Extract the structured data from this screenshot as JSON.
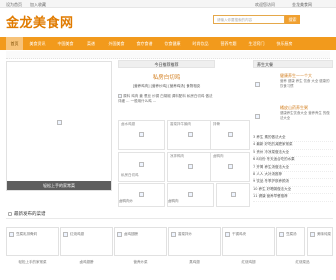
{
  "topbar": {
    "links": [
      "设为首页",
      "加入收藏"
    ],
    "right_link": "金龙美食网",
    "right_extra": "欢迎您访问"
  },
  "header": {
    "logo": "金龙美食网",
    "search_placeholder": "请输入你要搜索的内容",
    "search_button": "搜索"
  },
  "nav": {
    "items": [
      "首页",
      "美食资讯",
      "中国美食",
      "菜谱",
      "外国美食",
      "食疗食谱",
      "饮食健康",
      "时尚饮品",
      "营养专题",
      "生活窍门",
      "快乐厨房"
    ]
  },
  "slider": {
    "caption": "轻松上手的家常菜"
  },
  "center": {
    "title": "今日推荐推荐",
    "article_title": "私房白切鸡",
    "article_links": "[营养鸡肉] [营养炒鸡] [营养鸡汤] 食物相克",
    "summary": "原料 鸡肉 姜 葱丝 炒锅 白胡椒 调料配料 私房白切鸡 做法详细 ... 一般用什么鸡 ...",
    "thumbs": [
      {
        "label": "卤水鸡翅"
      },
      {
        "label": "香菜拌牛腩肉"
      },
      {
        "label": "私房白切鸡"
      },
      {
        "label": "凉拌鸭肉"
      },
      {
        "label": "卤鸭肉"
      },
      {
        "label": "排骨"
      }
    ],
    "under_labels": [
      "卤鸭肉炒",
      "卤鸭肉"
    ]
  },
  "right": {
    "title": "养生大餐",
    "promos": [
      {
        "title": "健康养生——个大",
        "desc": "营养 健康 养生 饮食 大全 健康的饮食习惯"
      },
      {
        "title": "橘皮山药养生粥",
        "desc": "健康养生饮食大全 营养养生 的做法大全"
      }
    ],
    "list": [
      "3 养生 素的做法大全",
      "4 最新 好吃的减肥家常菜",
      "5 贵州 冷凉菜做法大全",
      "6 8月份 冬天适合吃的水果",
      "7 开胃 养生汤做法大全",
      "8 人人 大补汤推荐",
      "9 饮品 冬季护肤养颜汤",
      "10 养生 好喝粥做法大全",
      "11 健康 营养早餐推荐"
    ]
  },
  "bottom": {
    "section_title": "最新发布的菜谱",
    "cards": [
      "豆腐乳排骨焖",
      "红烧鸡翅",
      "卤鸡翅膀",
      "香菜拌炒",
      "干锅鸡块",
      "豆腐汤",
      "美味炖菜"
    ],
    "captions": [
      "轻松上手的家常菜",
      "卤鸡翅膀",
      "营养炒菜",
      "蒸鸡翅",
      "红烧鸡翅",
      "红烧菜品"
    ]
  }
}
